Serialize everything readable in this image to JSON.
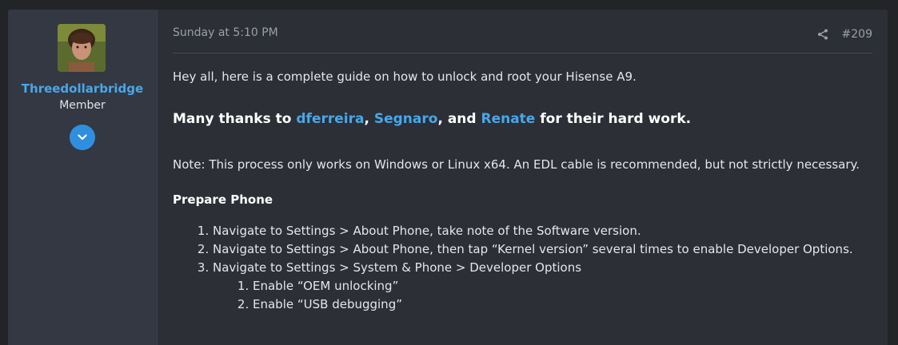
{
  "user": {
    "name": "Threedollarbridge",
    "title": "Member"
  },
  "post": {
    "date": "Sunday at 5:10 PM",
    "number": "#209",
    "intro": "Hey all, here is a complete guide on how to unlock and root your Hisense A9.",
    "thanks": {
      "prefix": "Many thanks to ",
      "user1": "dferreira",
      "sep1": ", ",
      "user2": "Segnaro",
      "sep2": ", and ",
      "user3": "Renate",
      "suffix": " for their hard work."
    },
    "note": "Note: This process only works on Windows or Linux x64. An EDL cable is recommended, but not strictly necessary.",
    "section_title": "Prepare Phone",
    "steps": [
      "Navigate to Settings > About Phone, take note of the Software version.",
      "Navigate to Settings > About Phone, then tap “Kernel version” several times to enable Developer Options.",
      "Navigate to Settings > System & Phone > Developer Options"
    ],
    "substeps": [
      "Enable “OEM unlocking”",
      "Enable “USB debugging”"
    ]
  },
  "icons": {
    "expand": "chevron-down-icon",
    "share": "share-icon"
  },
  "colors": {
    "link": "#47a7eb",
    "page_bg": "#222428",
    "post_bg": "#2c2f36",
    "user_col_bg": "#343842",
    "expand_button": "#2f8fde"
  }
}
